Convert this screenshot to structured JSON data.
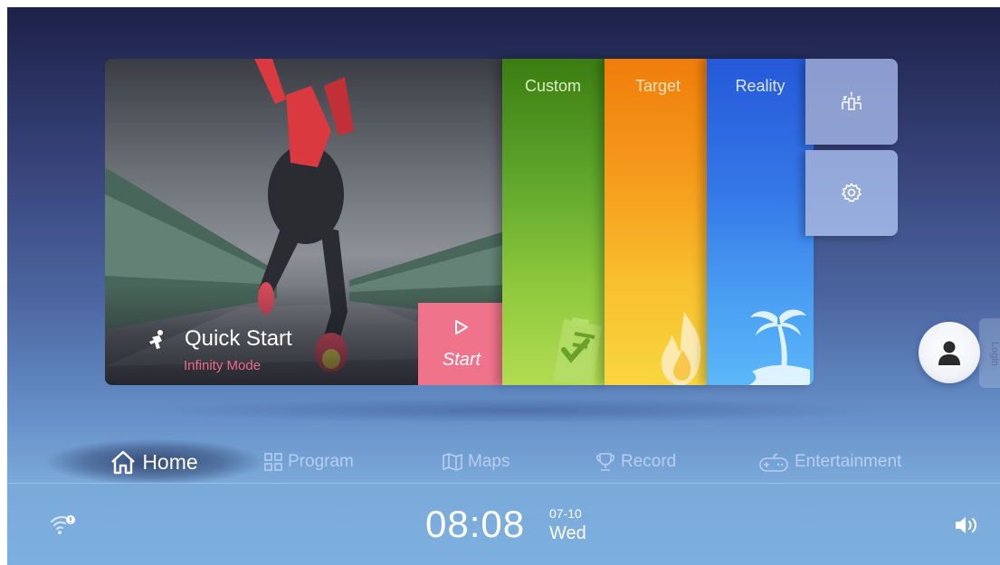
{
  "quick_start": {
    "title": "Quick Start",
    "subtitle": "Infinity Mode",
    "start_label": "Start"
  },
  "programs": [
    {
      "label": "Custom"
    },
    {
      "label": "Target"
    },
    {
      "label": "Reality"
    }
  ],
  "login": {
    "label": "Login"
  },
  "nav": {
    "home": "Home",
    "program": "Program",
    "maps": "Maps",
    "record": "Record",
    "entertainment": "Entertainment"
  },
  "status": {
    "time": "08:08",
    "date": "07-10",
    "weekday": "Wed"
  },
  "icons": {
    "quick_start": "running-figure-icon",
    "start": "play-icon",
    "custom": "clipboard-check-icon",
    "target": "flame-icon",
    "reality": "palm-island-icon",
    "leaderboard": "podium-icon",
    "settings": "gear-icon",
    "avatar": "user-icon",
    "home": "home-icon",
    "program": "grid-icon",
    "maps": "map-icon",
    "record": "trophy-icon",
    "entertainment": "gamepad-icon",
    "wifi": "wifi-alert-icon",
    "volume": "speaker-icon"
  },
  "colors": {
    "start_button": "#f0738c",
    "subtitle": "#f06a8a",
    "custom": "#5da42a",
    "target": "#f59a1c",
    "reality": "#3477e8"
  }
}
